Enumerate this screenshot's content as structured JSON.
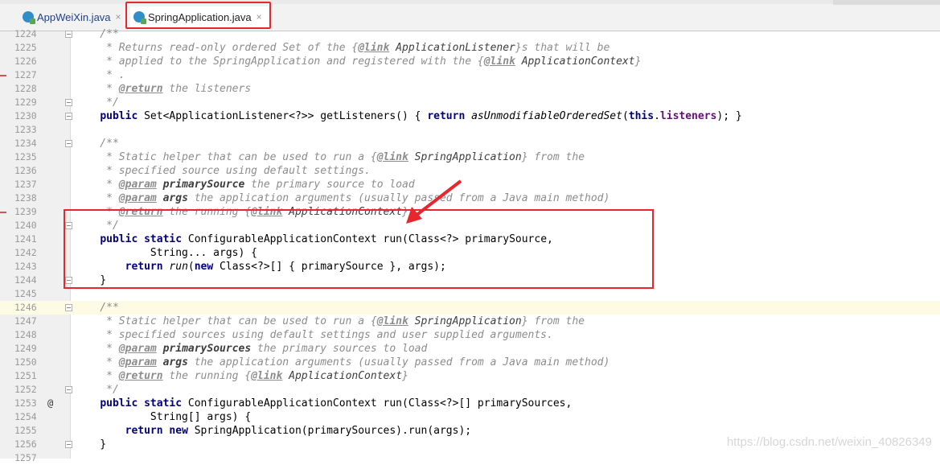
{
  "tabs": [
    {
      "label": "AppWeiXin.java",
      "close": "×",
      "active": false
    },
    {
      "label": "SpringApplication.java",
      "close": "×",
      "active": true
    }
  ],
  "watermark": "https://blog.csdn.net/weixin_40826349",
  "colors": {
    "highlight_box": "#e8262e",
    "keyword": "#000080",
    "comment": "#8c8c8c",
    "field": "#660e7a"
  },
  "lines": [
    {
      "n": "1224",
      "t": "    /**"
    },
    {
      "n": "1225",
      "t": "     * Returns read-only ordered Set of the {@link ApplicationListener}s that will be"
    },
    {
      "n": "1226",
      "t": "     * applied to the SpringApplication and registered with the {@link ApplicationContext}"
    },
    {
      "n": "1227",
      "t": "     * ."
    },
    {
      "n": "1228",
      "t": "     * @return the listeners"
    },
    {
      "n": "1229",
      "t": "     */"
    },
    {
      "n": "1230",
      "t": "    public Set<ApplicationListener<?>> getListeners() { return asUnmodifiableOrderedSet(this.listeners); }"
    },
    {
      "n": "1233",
      "t": ""
    },
    {
      "n": "1234",
      "t": "    /**"
    },
    {
      "n": "1235",
      "t": "     * Static helper that can be used to run a {@link SpringApplication} from the"
    },
    {
      "n": "1236",
      "t": "     * specified source using default settings."
    },
    {
      "n": "1237",
      "t": "     * @param primarySource the primary source to load"
    },
    {
      "n": "1238",
      "t": "     * @param args the application arguments (usually passed from a Java main method)"
    },
    {
      "n": "1239",
      "t": "     * @return the running {@link ApplicationContext}"
    },
    {
      "n": "1240",
      "t": "     */"
    },
    {
      "n": "1241",
      "t": "    public static ConfigurableApplicationContext run(Class<?> primarySource,"
    },
    {
      "n": "1242",
      "t": "            String... args) {"
    },
    {
      "n": "1243",
      "t": "        return run(new Class<?>[] { primarySource }, args);"
    },
    {
      "n": "1244",
      "t": "    }"
    },
    {
      "n": "1245",
      "t": ""
    },
    {
      "n": "1246",
      "t": "    /**"
    },
    {
      "n": "1247",
      "t": "     * Static helper that can be used to run a {@link SpringApplication} from the"
    },
    {
      "n": "1248",
      "t": "     * specified sources using default settings and user supplied arguments."
    },
    {
      "n": "1249",
      "t": "     * @param primarySources the primary sources to load"
    },
    {
      "n": "1250",
      "t": "     * @param args the application arguments (usually passed from a Java main method)"
    },
    {
      "n": "1251",
      "t": "     * @return the running {@link ApplicationContext}"
    },
    {
      "n": "1252",
      "t": "     */"
    },
    {
      "n": "1253",
      "t": "    public static ConfigurableApplicationContext run(Class<?>[] primarySources,"
    },
    {
      "n": "1254",
      "t": "            String[] args) {"
    },
    {
      "n": "1255",
      "t": "        return new SpringApplication(primarySources).run(args);"
    },
    {
      "n": "1256",
      "t": "    }"
    },
    {
      "n": "1257",
      "t": ""
    }
  ]
}
